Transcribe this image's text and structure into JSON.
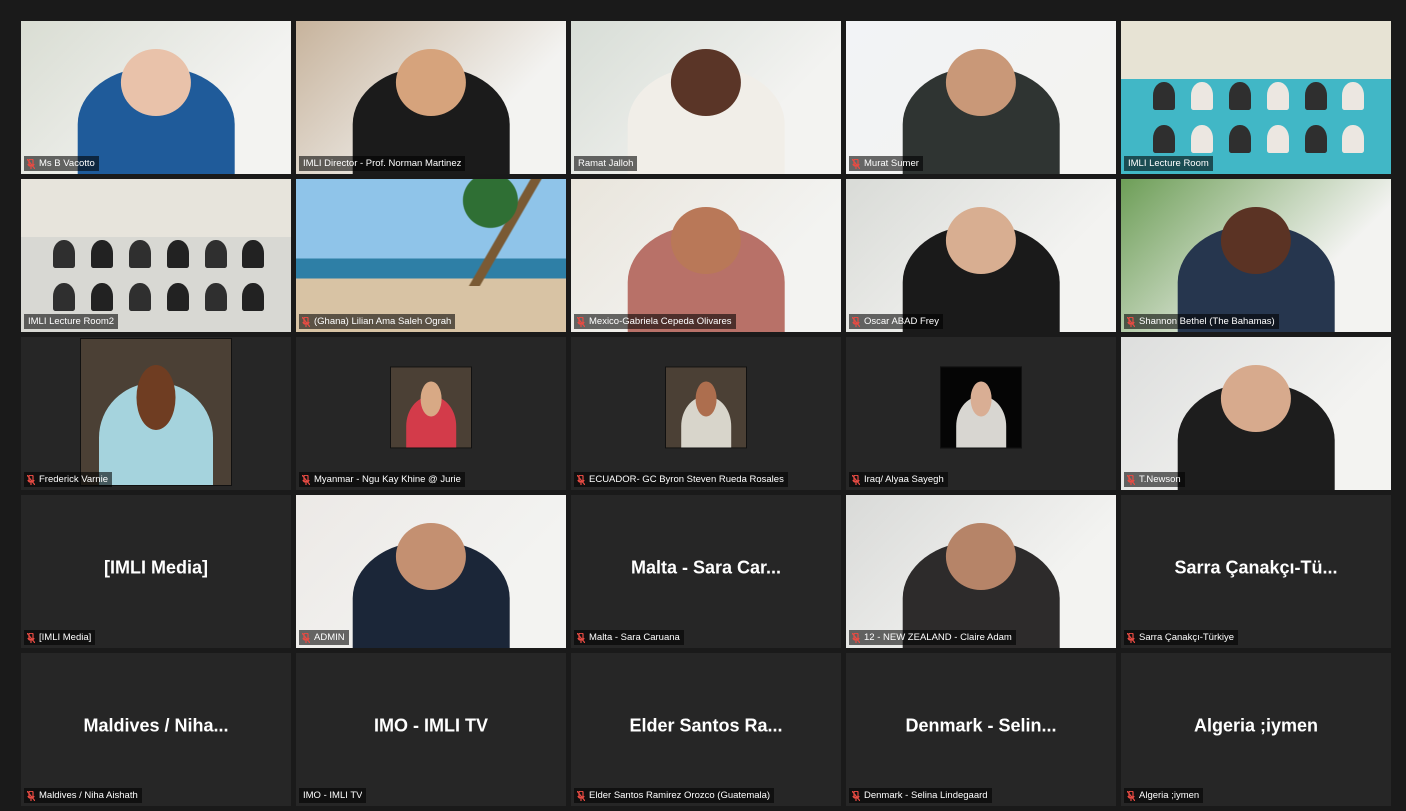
{
  "meeting": {
    "accent": "#d8e07a",
    "muted_icon": "microphone-muted-icon",
    "participants": [
      {
        "name": "Ms B Vacotto",
        "muted": true,
        "view": "video",
        "bg": "#d9ddd3",
        "shirt": "#1f5b9a",
        "face": "#e9c2aa"
      },
      {
        "name": "IMLI Director - Prof. Norman Martinez",
        "muted": false,
        "active": true,
        "view": "video",
        "bg": "#c7b39c",
        "shirt": "#1b1b1b",
        "face": "#d6a37c"
      },
      {
        "name": "Ramat Jalloh",
        "muted": false,
        "view": "video",
        "bg": "#d7ddd6",
        "shirt": "#f1eee8",
        "face": "#5a3527"
      },
      {
        "name": "Murat Sumer",
        "muted": true,
        "view": "video",
        "bg": "#f2f3f6",
        "shirt": "#2f3432",
        "face": "#c99878"
      },
      {
        "name": "IMLI Lecture Room",
        "muted": false,
        "view": "video",
        "bg": "#41b7c6",
        "shirt": "#ece7e1",
        "face": "#8f5b46"
      },
      {
        "name": "IMLI Lecture Room2",
        "muted": false,
        "view": "video",
        "bg": "#e5e3df",
        "shirt": "#222222",
        "face": "#a55c3d"
      },
      {
        "name": "(Ghana) Lilian Ama Saleh Ograh",
        "muted": true,
        "view": "video",
        "bg": "#8fc4e9",
        "shirt": "#1b1b1b",
        "face": "#7a4d3e"
      },
      {
        "name": "Mexico-Gabriela Cepeda Olivares",
        "muted": true,
        "view": "video",
        "bg": "#e9e5dc",
        "shirt": "#b87168",
        "face": "#b97858"
      },
      {
        "name": "Oscar ABAD Frey",
        "muted": true,
        "view": "video",
        "bg": "#d9dbd7",
        "shirt": "#1a1a1a",
        "face": "#d8ae91"
      },
      {
        "name": "Shannon Bethel (The Bahamas)",
        "muted": true,
        "view": "video",
        "bg": "#6d9e57",
        "shirt": "#26364e",
        "face": "#5b3324"
      },
      {
        "name": "Frederick Varnie",
        "muted": true,
        "view": "photo-large",
        "bg": "#262626",
        "shirt": "#a5d3dd",
        "face": "#6f3d22"
      },
      {
        "name": "Myanmar - Ngu Kay Khine @ Jurie",
        "muted": true,
        "view": "photo-small",
        "bg": "#262626",
        "shirt": "#d33b4a",
        "face": "#d8a985"
      },
      {
        "name": "ECUADOR- GC Byron Steven Rueda Rosales",
        "muted": true,
        "view": "photo-small",
        "bg": "#262626",
        "shirt": "#d8d5cb",
        "face": "#ad6e4e"
      },
      {
        "name": "Iraq/ Alyaa Sayegh",
        "muted": true,
        "view": "photo-small",
        "bg": "#262626",
        "shirt": "#d8d6d1",
        "face": "#d9ae94"
      },
      {
        "name": "T.Newson",
        "muted": true,
        "view": "video",
        "bg": "#dddedd",
        "shirt": "#1d1d1d",
        "face": "#d7aa8d"
      },
      {
        "name": "[IMLI Media]",
        "muted": true,
        "view": "name",
        "display": "[IMLI Media]"
      },
      {
        "name": "ADMIN",
        "muted": true,
        "view": "video",
        "bg": "#ece9e6",
        "shirt": "#1b2638",
        "face": "#c49071"
      },
      {
        "name": "Malta - Sara Caruana",
        "muted": true,
        "view": "name",
        "display": "Malta - Sara Car..."
      },
      {
        "name": "12 - NEW ZEALAND - Claire Adam",
        "muted": true,
        "view": "video",
        "bg": "#d9dad8",
        "shirt": "#2d2b2b",
        "face": "#b68468"
      },
      {
        "name": "Sarra Çanakçı-Türkiye",
        "muted": true,
        "view": "name",
        "display": "Sarra Çanakçı-Tü..."
      },
      {
        "name": "Maldives / Niha Aishath",
        "muted": true,
        "view": "name",
        "display": "Maldives / Niha..."
      },
      {
        "name": "IMO - IMLI TV",
        "muted": false,
        "view": "name",
        "display": "IMO - IMLI TV"
      },
      {
        "name": "Elder Santos Ramirez Orozco (Guatemala)",
        "muted": true,
        "view": "name",
        "display": "Elder Santos Ra..."
      },
      {
        "name": "Denmark - Selina Lindegaard",
        "muted": true,
        "view": "name",
        "display": "Denmark - Selin..."
      },
      {
        "name": "Algeria ;iymen",
        "muted": true,
        "view": "name",
        "display": "Algeria ;iymen"
      }
    ]
  }
}
